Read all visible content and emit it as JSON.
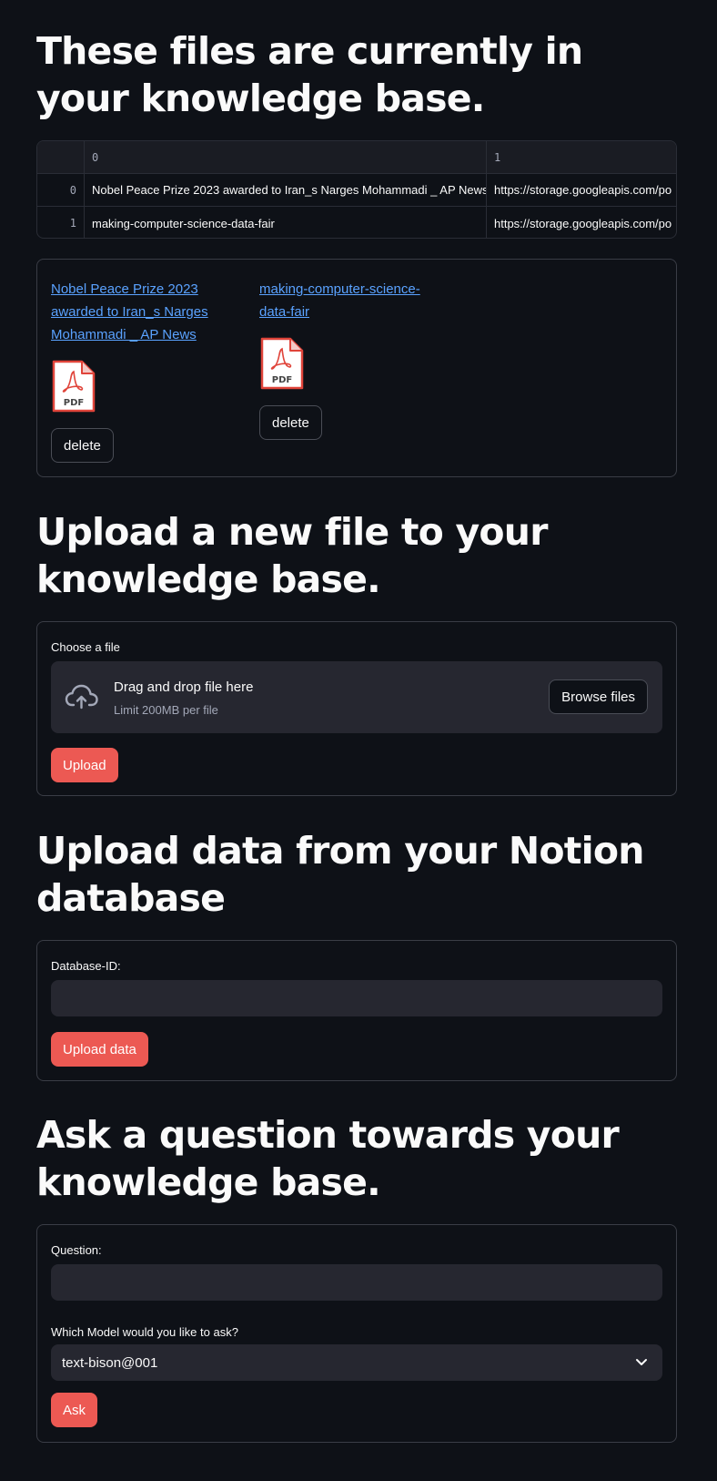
{
  "sections": {
    "files_title": "These files are currently in your knowledge base.",
    "upload_title": "Upload a new file to your knowledge base.",
    "notion_title": "Upload data from your Notion database",
    "ask_title": "Ask a question towards your knowledge base."
  },
  "table": {
    "columns": [
      "0",
      "1"
    ],
    "rows": [
      {
        "index": "0",
        "c0": "Nobel Peace Prize 2023 awarded to Iran_s Narges Mohammadi _ AP News",
        "c1": "https://storage.googleapis.com/po"
      },
      {
        "index": "1",
        "c0": "making-computer-science-data-fair",
        "c1": "https://storage.googleapis.com/po"
      }
    ]
  },
  "files": [
    {
      "link": "Nobel Peace Prize 2023 awarded to Iran_s Narges Mohammadi _ AP News",
      "icon": "pdf-icon",
      "icon_label": "PDF",
      "delete_label": "delete"
    },
    {
      "link": "making-computer-science-data-fair",
      "icon": "pdf-icon",
      "icon_label": "PDF",
      "delete_label": "delete"
    }
  ],
  "uploader": {
    "label": "Choose a file",
    "drop_text": "Drag and drop file here",
    "limit_text": "Limit 200MB per file",
    "browse_label": "Browse files",
    "upload_label": "Upload",
    "icon": "cloud-upload-icon"
  },
  "notion": {
    "label": "Database-ID:",
    "value": "",
    "button_label": "Upload data"
  },
  "ask": {
    "question_label": "Question:",
    "question_value": "",
    "model_label": "Which Model would you like to ask?",
    "model_selected": "text-bison@001",
    "ask_label": "Ask"
  },
  "colors": {
    "background": "#0e1117",
    "primary": "#ec5953",
    "link": "#5aa2ff",
    "input_bg": "#262730"
  }
}
